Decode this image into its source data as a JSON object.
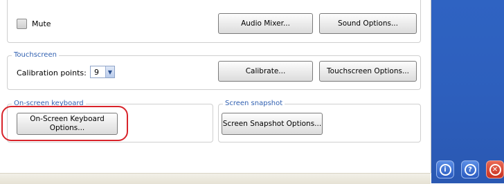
{
  "audio": {
    "mute_label": "Mute",
    "mixer_button": "Audio Mixer...",
    "sound_options_button": "Sound Options..."
  },
  "touchscreen": {
    "title": "Touchscreen",
    "calibration_label": "Calibration points:",
    "calibration_value": "9",
    "calibrate_button": "Calibrate...",
    "options_button": "Touchscreen Options..."
  },
  "keyboard": {
    "title": "On-screen keyboard",
    "options_button_line1": "On-Screen Keyboard",
    "options_button_line2": "Options..."
  },
  "snapshot": {
    "title": "Screen snapshot",
    "options_button": "Screen Snapshot Options..."
  },
  "side_buttons": [
    {
      "icon": "info-icon",
      "glyph": "i",
      "color": "#3a6fd0"
    },
    {
      "icon": "help-icon",
      "glyph": "?",
      "color": "#3a6fd0"
    },
    {
      "icon": "close-icon",
      "glyph": "✕",
      "color": "#d43a2a"
    }
  ],
  "annotation_color": "#d8232a"
}
